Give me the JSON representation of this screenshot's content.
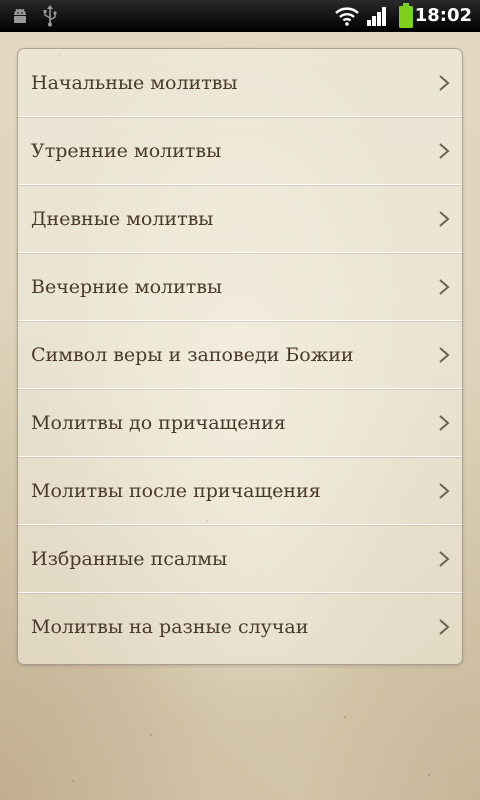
{
  "status_bar": {
    "time": "18:02",
    "icons": [
      "android-debug-icon",
      "usb-icon",
      "wifi-icon",
      "signal-icon",
      "battery-icon"
    ]
  },
  "menu": {
    "items": [
      {
        "label": "Начальные молитвы",
        "icon": "chevron-right-icon"
      },
      {
        "label": "Утренние молитвы",
        "icon": "chevron-right-icon"
      },
      {
        "label": "Дневные молитвы",
        "icon": "chevron-right-icon"
      },
      {
        "label": "Вечерние молитвы",
        "icon": "chevron-right-icon"
      },
      {
        "label": "Символ веры и заповеди Божии",
        "icon": "chevron-right-icon"
      },
      {
        "label": "Молитвы до причащения",
        "icon": "chevron-right-icon"
      },
      {
        "label": "Молитвы после причащения",
        "icon": "chevron-right-icon"
      },
      {
        "label": "Избранные псалмы",
        "icon": "chevron-right-icon"
      },
      {
        "label": "Молитвы на разные случаи",
        "icon": "chevron-right-icon"
      }
    ]
  },
  "colors": {
    "text": "#4a3a2c",
    "paper": "#ddd3bd",
    "statusbar": "#000000",
    "battery": "#7fcf1e"
  }
}
